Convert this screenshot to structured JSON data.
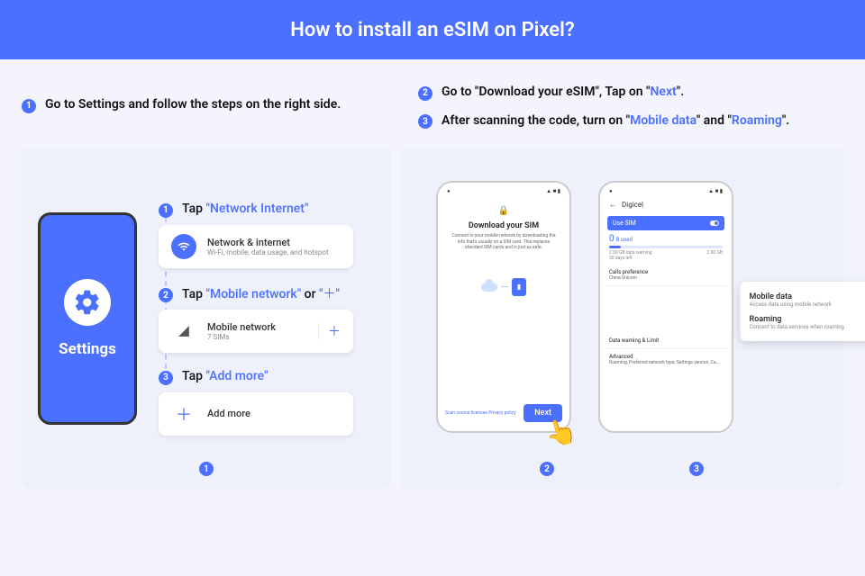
{
  "header": {
    "title": "How to install an eSIM on Pixel?"
  },
  "instructions": {
    "left": {
      "num": "1",
      "text": "Go to Settings and follow the steps on the right side."
    },
    "right": [
      {
        "num": "2",
        "prefix": "Go to \"Download your eSIM\", Tap on \"",
        "link": "Next",
        "suffix": "\"."
      },
      {
        "num": "3",
        "prefix": "After scanning the code, turn on \"",
        "link1": "Mobile data",
        "mid": "\" and \"",
        "link2": "Roaming",
        "suffix": "\"."
      }
    ]
  },
  "phone_mock": {
    "label": "Settings"
  },
  "steps": [
    {
      "num": "1",
      "prefix": "Tap ",
      "link": "\"Network Internet\"",
      "card": {
        "title": "Network & internet",
        "subtitle": "Wi-Fi, mobile, data usage, and hotspot"
      }
    },
    {
      "num": "2",
      "prefix": "Tap ",
      "link": "\"Mobile network\"",
      "mid": " or ",
      "link2": "\"＋\"",
      "card": {
        "title": "Mobile network",
        "subtitle": "7 SIMs"
      }
    },
    {
      "num": "3",
      "prefix": "Tap ",
      "link": "\"Add more\"",
      "card": {
        "title": "Add more"
      }
    }
  ],
  "left_badge": "1",
  "download_phone": {
    "title": "Download your SIM",
    "desc": "Connect to your mobile network by downloading the info that's usually on a SIM card. This replaces standard SIM cards and is just as safe.",
    "link_scan": "Scan source licenses",
    "link_privacy": "Privacy policy",
    "next": "Next"
  },
  "carrier_phone": {
    "carrier": "Digicel",
    "use_sim": "Use SIM",
    "used_label": "B used",
    "used_n": "0",
    "warning": "2.00 GB data warning",
    "days": "30 days left",
    "limit": "2.00 GB",
    "pref": "Calls preference",
    "pref_v": "China Unicom",
    "dw": "Data warning & Limit",
    "adv": "Advanced",
    "adv_v": "Roaming, Preferred network type, Settings version, Ca..."
  },
  "overlay": {
    "mobile": {
      "title": "Mobile data",
      "sub": "Access data using mobile network"
    },
    "roaming": {
      "title": "Roaming",
      "sub": "Connect to data services when roaming"
    }
  },
  "right_badges": [
    "2",
    "3"
  ]
}
